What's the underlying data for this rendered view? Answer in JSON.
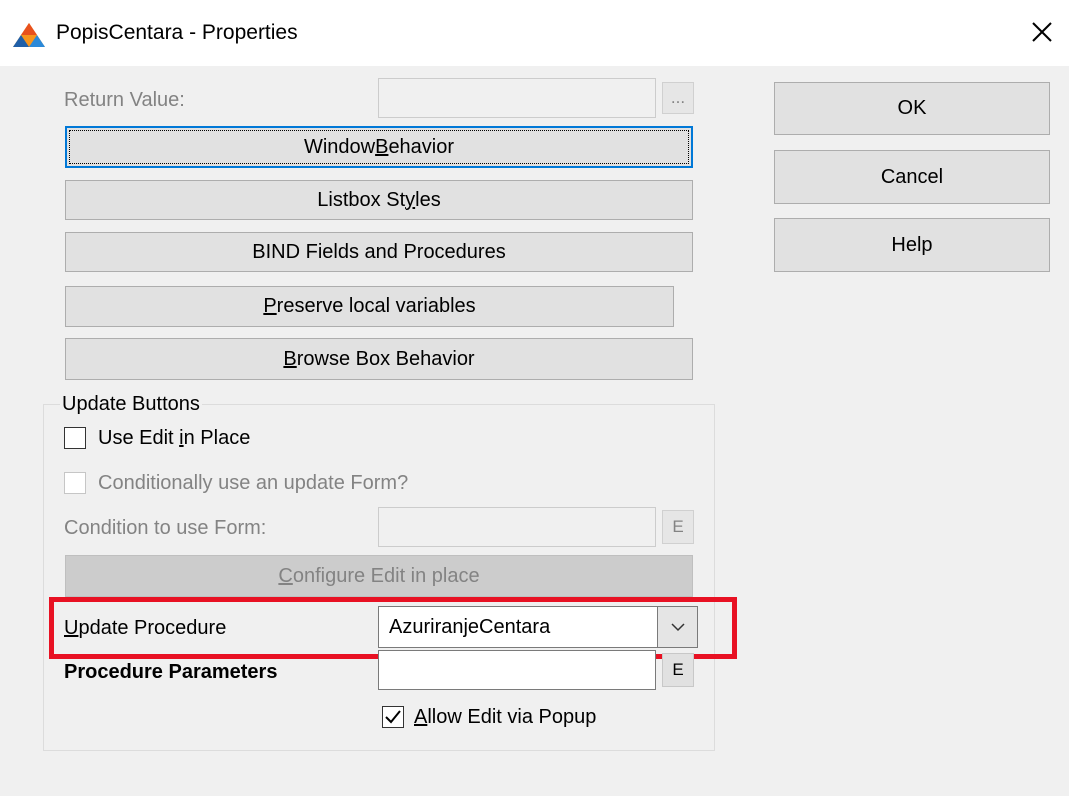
{
  "window": {
    "title": "PopisCentara - Properties",
    "icon": "clarion-app-icon"
  },
  "return_value": {
    "label": "Return Value:",
    "value": "",
    "ellipsis": "..."
  },
  "buttons": {
    "window_behavior": {
      "pre": "Window ",
      "key": "B",
      "post": "ehavior"
    },
    "listbox_styles": {
      "pre": "Listbox St",
      "key": "y",
      "post": "les"
    },
    "bind_fields": {
      "pre": "BIND Fields and Procedures",
      "key": "",
      "post": ""
    },
    "preserve_local": {
      "pre": "",
      "key": "P",
      "post": "reserve local variables"
    },
    "browse_box": {
      "pre": "",
      "key": "B",
      "post": "rowse Box Behavior"
    }
  },
  "side_buttons": {
    "ok": "OK",
    "cancel": "Cancel",
    "help": "Help"
  },
  "update_buttons": {
    "group_title": "Update Buttons",
    "use_edit_in_place": {
      "pre": "Use Edit ",
      "key": "i",
      "post": "n Place",
      "checked": false
    },
    "conditionally_update_form": {
      "label": "Conditionally use an update Form?",
      "checked": false,
      "disabled": true
    },
    "condition_to_use_form": {
      "label": "Condition to use Form:",
      "value": "",
      "button": "E"
    },
    "configure_edit": {
      "pre": "",
      "key": "C",
      "post": "onfigure Edit in place"
    },
    "update_procedure": {
      "label_key": "U",
      "label_rest": "pdate Procedure",
      "value": "AzuriranjeCentara"
    },
    "procedure_parameters": {
      "label": "Procedure Parameters",
      "value": "",
      "button": "E"
    },
    "allow_edit_popup": {
      "pre": "",
      "key": "A",
      "post": "llow Edit via Popup",
      "checked": true
    }
  },
  "colors": {
    "highlight": "#e81123",
    "focus": "#0078d7"
  }
}
